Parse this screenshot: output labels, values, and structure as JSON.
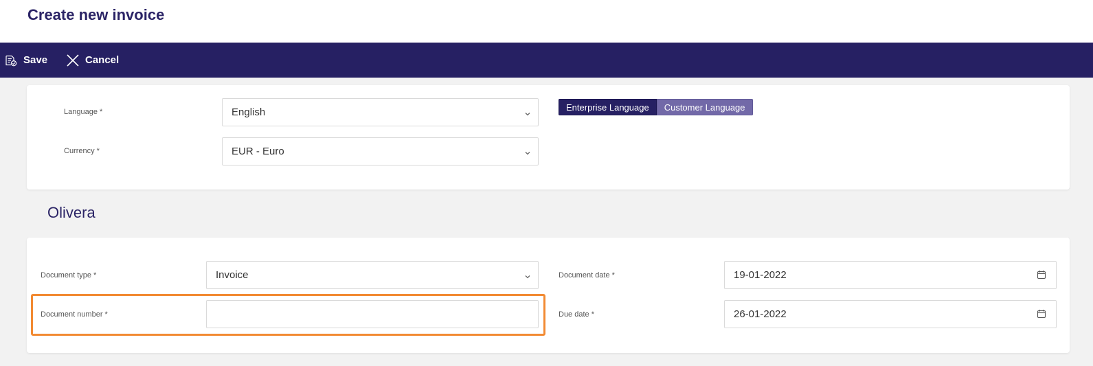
{
  "page": {
    "title": "Create new invoice"
  },
  "toolbar": {
    "save_label": "Save",
    "cancel_label": "Cancel"
  },
  "settings": {
    "language_label": "Language *",
    "language_value": "English",
    "currency_label": "Currency *",
    "currency_value": "EUR - Euro",
    "toggle": {
      "enterprise": "Enterprise Language",
      "customer": "Customer Language",
      "selected": "Enterprise Language"
    }
  },
  "section": {
    "title": "Olivera"
  },
  "document": {
    "type_label": "Document type *",
    "type_value": "Invoice",
    "number_label": "Document number *",
    "number_value": "",
    "date_label": "Document date *",
    "date_value": "19-01-2022",
    "due_label": "Due date *",
    "due_value": "26-01-2022"
  },
  "colors": {
    "brand": "#262063",
    "title": "#2b2466",
    "toggle_inactive": "#7269a8",
    "highlight": "#f28a32",
    "background": "#f2f2f2"
  },
  "icons": {
    "save": "save-document-icon",
    "cancel": "close-icon",
    "dropdown": "chevron-down-icon",
    "calendar": "calendar-icon"
  }
}
